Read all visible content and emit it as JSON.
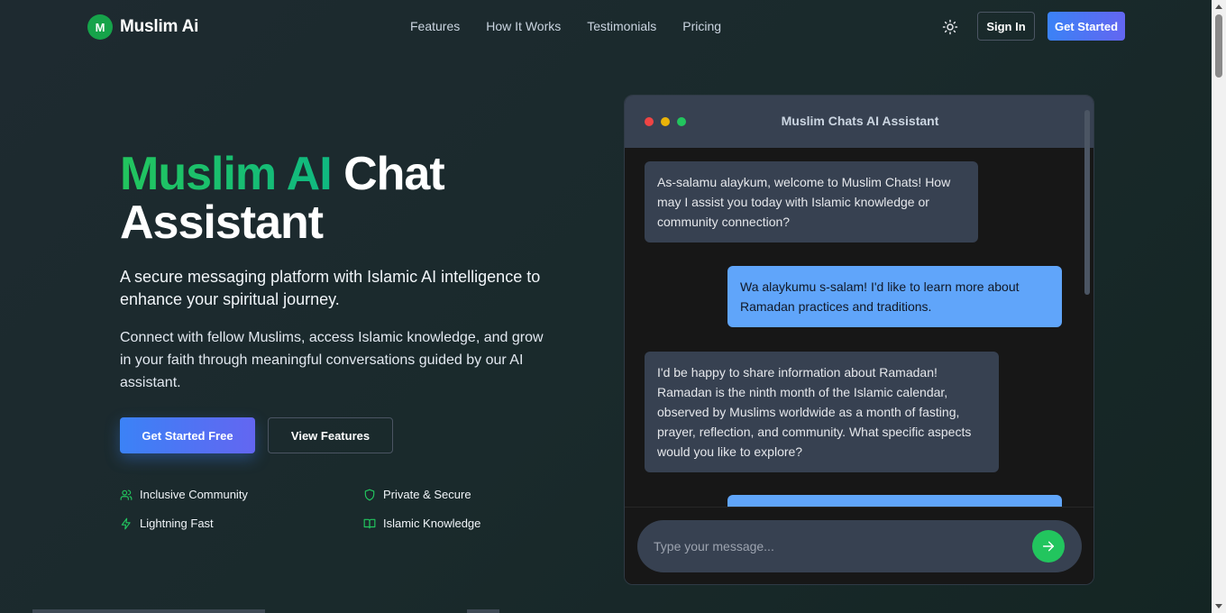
{
  "brand": {
    "initial": "M",
    "name": "Muslim Ai",
    "color": "#16a34a"
  },
  "nav": {
    "links": [
      "Features",
      "How It Works",
      "Testimonials",
      "Pricing"
    ],
    "theme_icon": "sun-icon",
    "signin_label": "Sign In",
    "getstarted_label": "Get Started"
  },
  "hero": {
    "title_accent": "Muslim AI",
    "title_rest": " Chat Assistant",
    "subtitle": "A secure messaging platform with Islamic AI intelligence to enhance your spiritual journey.",
    "description": "Connect with fellow Muslims, access Islamic knowledge, and grow in your faith through meaningful conversations guided by our AI assistant.",
    "cta_primary": "Get Started Free",
    "cta_secondary": "View Features",
    "features": [
      {
        "label": "Inclusive Community",
        "icon": "users-icon"
      },
      {
        "label": "Private & Secure",
        "icon": "shield-icon"
      },
      {
        "label": "Lightning Fast",
        "icon": "lightning-icon"
      },
      {
        "label": "Islamic Knowledge",
        "icon": "book-icon"
      }
    ]
  },
  "chat": {
    "title": "Muslim Chats AI Assistant",
    "window_dots": [
      "#ef4444",
      "#eab308",
      "#22c55e"
    ],
    "messages": [
      {
        "role": "bot",
        "text": "As-salamu alaykum, welcome to Muslim Chats! How may I assist you today with Islamic knowledge or community connection?"
      },
      {
        "role": "user",
        "text": "Wa alaykumu s-salam! I'd like to learn more about Ramadan practices and traditions."
      },
      {
        "role": "bot",
        "text": "I'd be happy to share information about Ramadan! Ramadan is the ninth month of the Islamic calendar, observed by Muslims worldwide as a month of fasting, prayer, reflection, and community. What specific aspects would you like to explore?"
      },
      {
        "role": "user",
        "text": ""
      }
    ],
    "input_placeholder": "Type your message...",
    "send_icon": "arrow-right-icon"
  },
  "colors": {
    "accent": "#22c55e",
    "primary": "#3b82f6",
    "user_bubble": "#60a5fa",
    "bot_bubble": "#374151"
  }
}
